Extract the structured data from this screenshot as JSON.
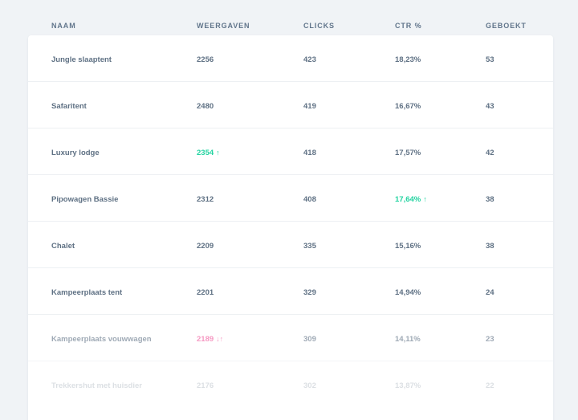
{
  "columns": {
    "name": "NAAM",
    "views": "WEERGAVEN",
    "clicks": "CLICKS",
    "ctr": "CTR %",
    "booked": "GEBOEKT"
  },
  "colors": {
    "trend_up": "#22d3a0",
    "trend_down": "#f0559a",
    "text": "#5f7184",
    "background": "#f0f3f6"
  },
  "rows": [
    {
      "name": "Jungle slaaptent",
      "views": "2256",
      "clicks": "423",
      "ctr": "18,23%",
      "booked": "53"
    },
    {
      "name": "Safaritent",
      "views": "2480",
      "clicks": "419",
      "ctr": "16,67%",
      "booked": "43"
    },
    {
      "name": "Luxury lodge",
      "views": "2354",
      "views_icon": "arrow-up-icon",
      "views_arrow": "↑",
      "clicks": "418",
      "ctr": "17,57%",
      "booked": "42"
    },
    {
      "name": "Pipowagen Bassie",
      "views": "2312",
      "clicks": "408",
      "ctr": "17,64%",
      "ctr_icon": "arrow-up-icon",
      "ctr_arrow": "↑",
      "booked": "38"
    },
    {
      "name": "Chalet",
      "views": "2209",
      "clicks": "335",
      "ctr": "15,16%",
      "booked": "38"
    },
    {
      "name": "Kampeerplaats tent",
      "views": "2201",
      "clicks": "329",
      "ctr": "14,94%",
      "booked": "24"
    },
    {
      "name": "Kampeerplaats vouwwagen",
      "views": "2189",
      "views_icon": "arrow-down-up-icon",
      "views_arrow": "↓↑",
      "clicks": "309",
      "ctr": "14,11%",
      "booked": "23"
    },
    {
      "name": "Trekkershut met huisdier",
      "views": "2176",
      "clicks": "302",
      "ctr": "13,87%",
      "booked": "22"
    }
  ]
}
